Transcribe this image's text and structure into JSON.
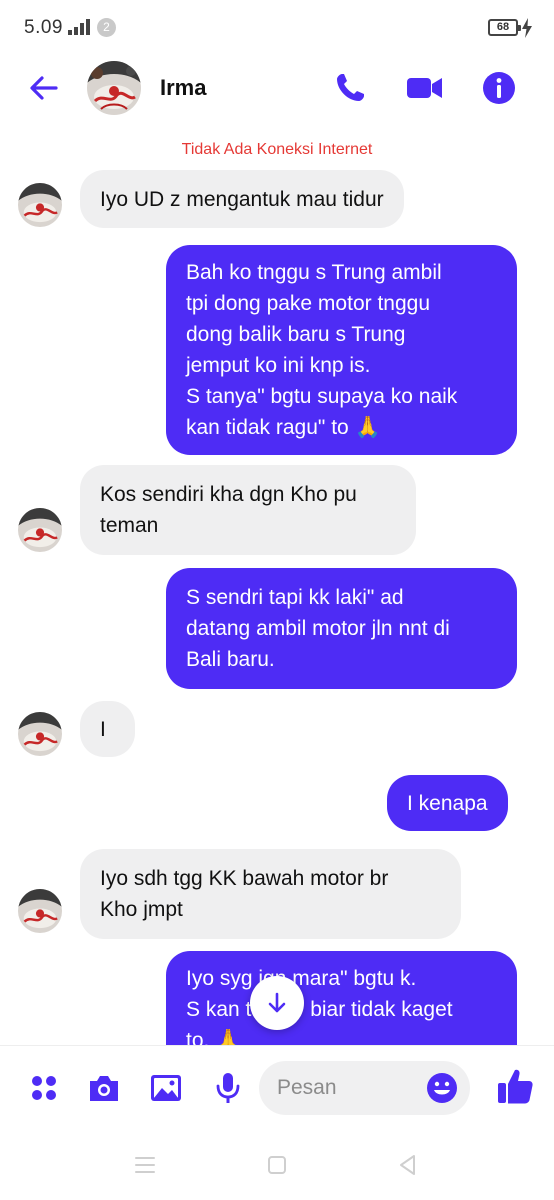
{
  "status_bar": {
    "time": "5.09",
    "notification_count": "2",
    "battery": "68"
  },
  "header": {
    "contact_name": "Irma",
    "icons": [
      "back-arrow-icon",
      "phone-icon",
      "video-camera-icon",
      "info-icon"
    ]
  },
  "notice": "Tidak Ada Koneksi Internet",
  "messages": [
    {
      "from": "them",
      "text": "Iyo UD z mengantuk mau tidur"
    },
    {
      "from": "me",
      "text": "Bah ko tnggu s Trung ambil\ntpi dong pake motor tnggu\ndong balik baru s Trung\njemput ko ini knp is.\nS tanya\" bgtu supaya ko naik\nkan tidak ragu\" to 🙏"
    },
    {
      "from": "them",
      "text": "Kos sendiri kha dgn Kho pu\nteman"
    },
    {
      "from": "me",
      "text": "S sendri tapi kk laki\" ad\ndatang ambil motor jln nnt di\nBali baru."
    },
    {
      "from": "them",
      "text": "I"
    },
    {
      "from": "me",
      "text": "I kenapa"
    },
    {
      "from": "them",
      "text": "Iyo sdh tgg KK bawah motor br\nKho jmpt"
    },
    {
      "from": "me",
      "text": "Iyo syg jgn mara\" bgtu k.\nS kan tanya\" biar tidak kaget\nto. 🙏"
    }
  ],
  "composer": {
    "placeholder": "Pesan",
    "icons": [
      "apps-grid-icon",
      "camera-icon",
      "image-icon",
      "microphone-icon",
      "emoji-icon",
      "thumbs-up-icon"
    ]
  },
  "colors": {
    "accent": "#4e2cf5",
    "incoming_bubble": "#efeff0",
    "notice": "#e53935"
  }
}
